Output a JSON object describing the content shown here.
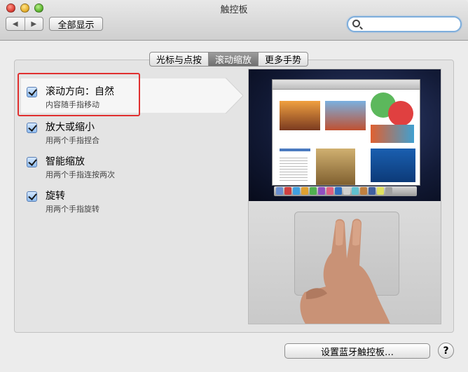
{
  "window": {
    "title": "触控板"
  },
  "toolbar": {
    "back": "◀",
    "forward": "▶",
    "show_all": "全部显示",
    "search_placeholder": ""
  },
  "tabs": [
    {
      "label": "光标与点按",
      "active": false
    },
    {
      "label": "滚动缩放",
      "active": true
    },
    {
      "label": "更多手势",
      "active": false
    }
  ],
  "options": [
    {
      "title": "滚动方向：自然",
      "desc": "内容随手指移动",
      "checked": true,
      "selected": true
    },
    {
      "title": "放大或缩小",
      "desc": "用两个手指捏合",
      "checked": true
    },
    {
      "title": "智能缩放",
      "desc": "用两个手指连按两次",
      "checked": true
    },
    {
      "title": "旋转",
      "desc": "用两个手指旋转",
      "checked": true
    }
  ],
  "footer": {
    "bluetooth_button": "设置蓝牙触控板…",
    "help": "?"
  },
  "colors": {
    "highlight": "#e03030",
    "active_tab": "#7d7d7d"
  },
  "icons": {
    "search": "search-icon",
    "help": "help-icon"
  }
}
